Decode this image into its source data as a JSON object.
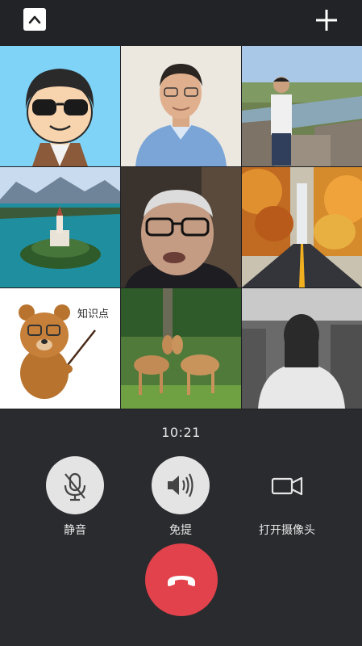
{
  "header": {
    "collapse_icon": "chevron-up-icon",
    "add_icon": "plus-icon"
  },
  "participants": [
    {
      "avatar": "cartoon-man-sunglasses-avatar"
    },
    {
      "avatar": "man-blue-shirt-photo"
    },
    {
      "avatar": "man-great-wall-photo"
    },
    {
      "avatar": "lake-bled-island-photo"
    },
    {
      "avatar": "elderly-man-glasses-video"
    },
    {
      "avatar": "autumn-forest-road-photo"
    },
    {
      "avatar": "cartoon-bear-teacher-avatar",
      "caption": "知识点"
    },
    {
      "avatar": "two-deer-photo"
    },
    {
      "avatar": "woman-back-cityscape-photo"
    }
  ],
  "call": {
    "timer": "10:21",
    "mute_label": "静音",
    "speaker_label": "免提",
    "camera_label": "打开摄像头"
  },
  "colors": {
    "background": "#2a2b2f",
    "hangup": "#e2424b",
    "control_circle": "#e4e4e4"
  }
}
